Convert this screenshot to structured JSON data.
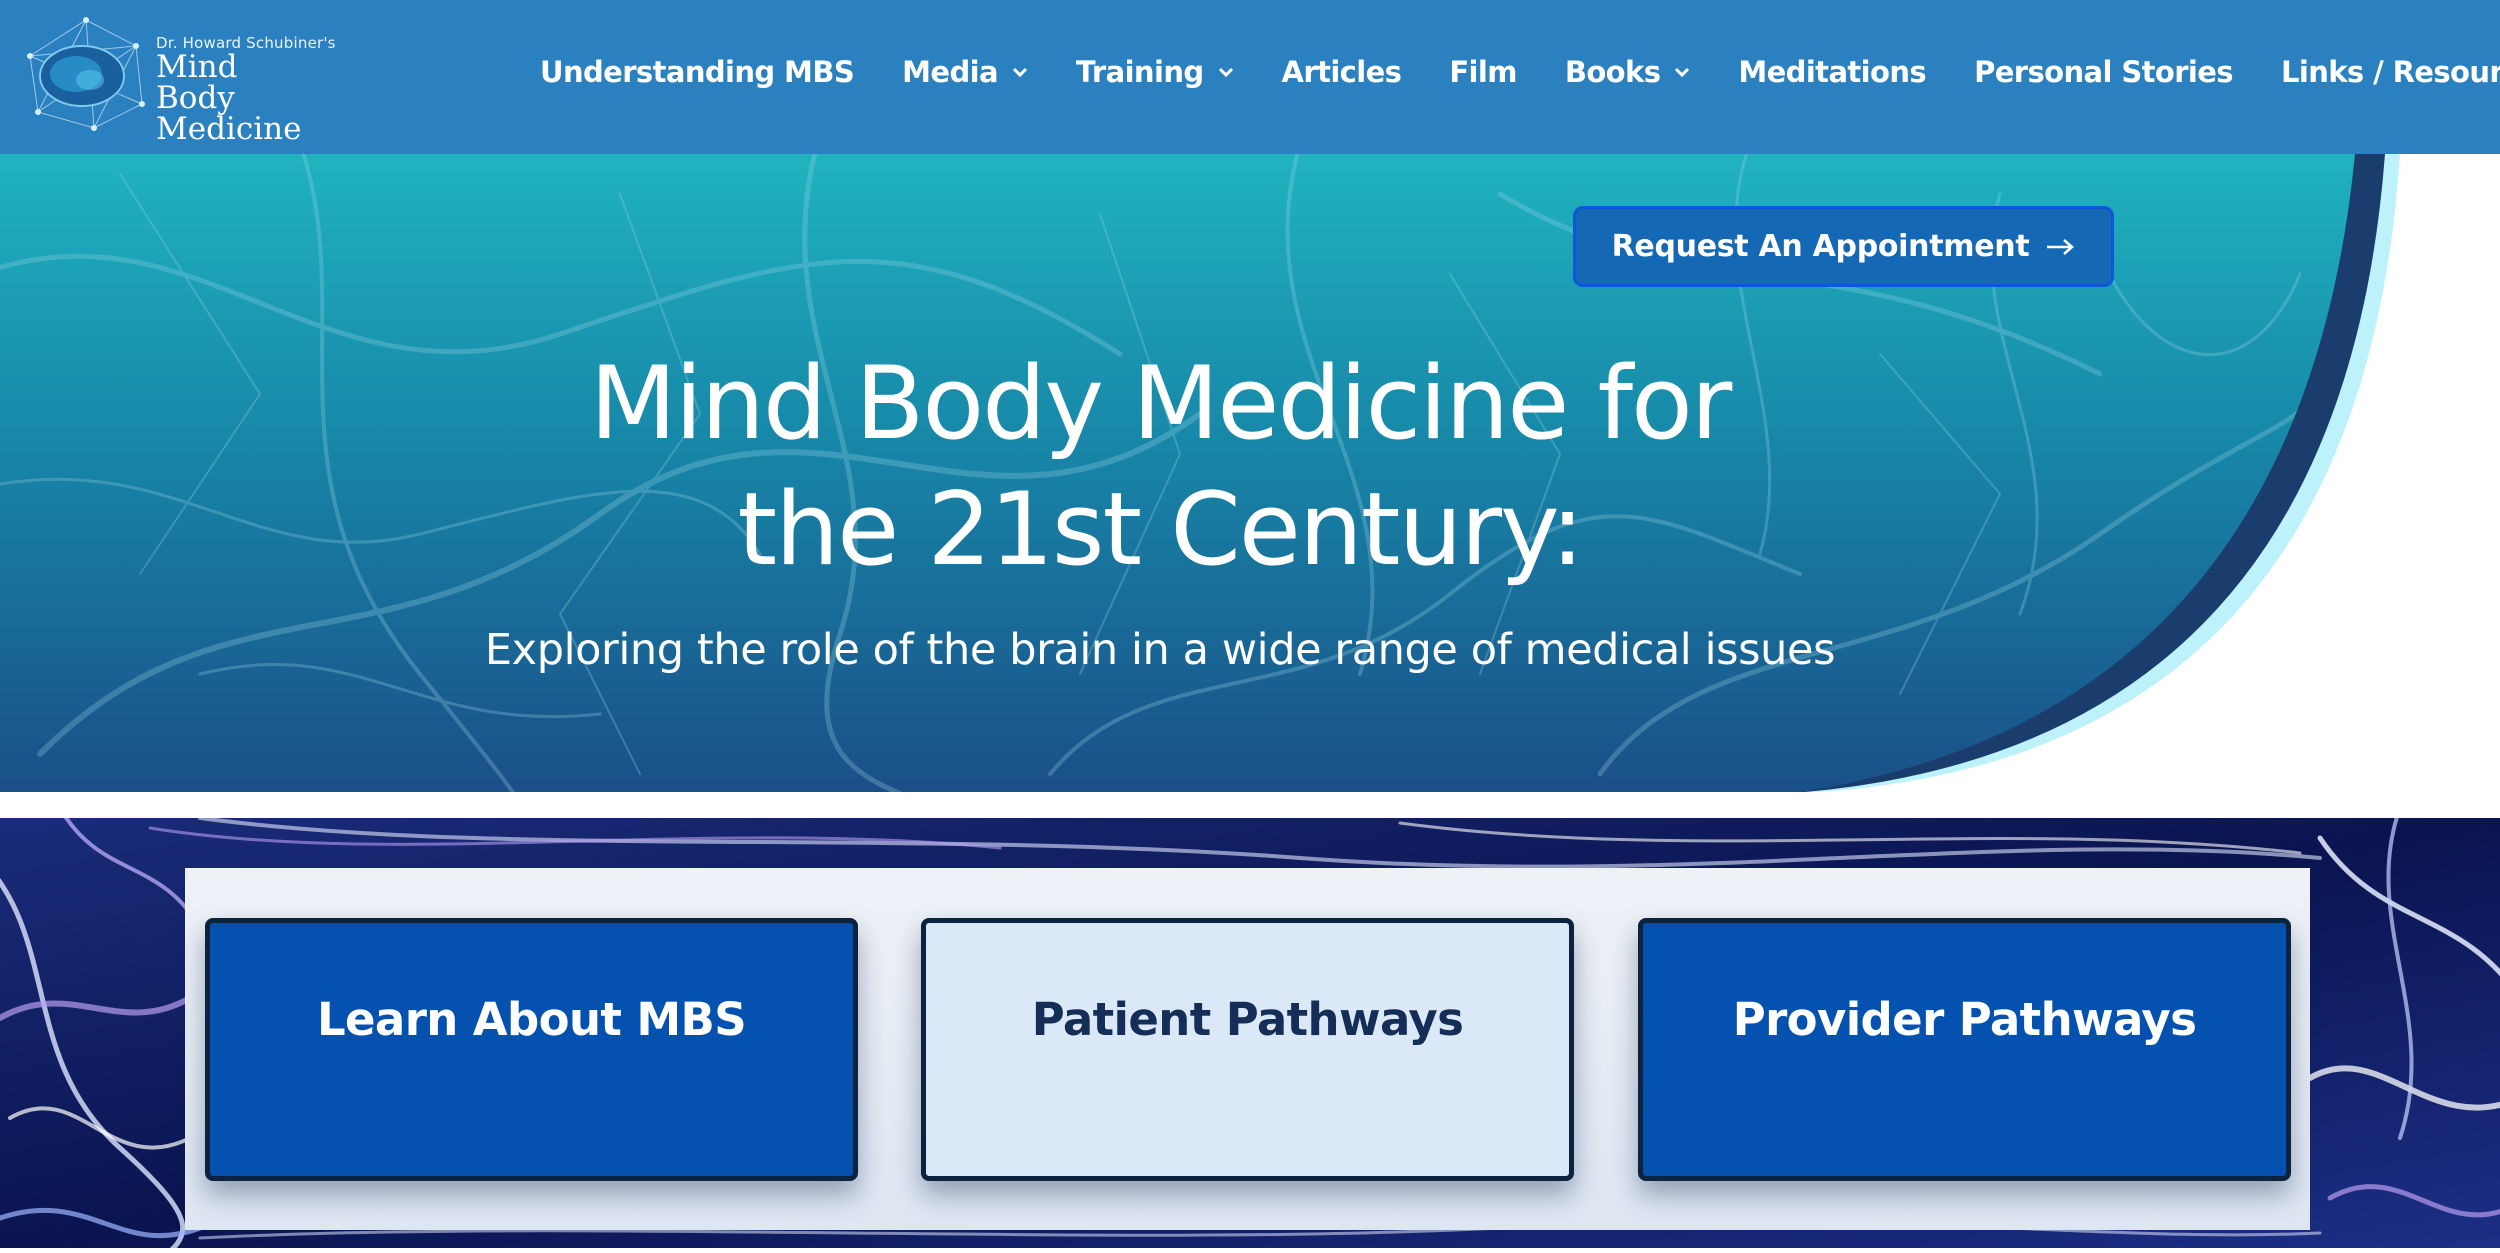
{
  "logo": {
    "small_text": "Dr. Howard Schubiner's",
    "title_line1": "Mind Body",
    "title_line2": "Medicine"
  },
  "nav": {
    "items": [
      {
        "label": "Understanding MBS",
        "has_dropdown": false
      },
      {
        "label": "Media",
        "has_dropdown": true
      },
      {
        "label": "Training",
        "has_dropdown": true
      },
      {
        "label": "Articles",
        "has_dropdown": false
      },
      {
        "label": "Film",
        "has_dropdown": false
      },
      {
        "label": "Books",
        "has_dropdown": true
      },
      {
        "label": "Meditations",
        "has_dropdown": false
      },
      {
        "label": "Personal Stories",
        "has_dropdown": false
      },
      {
        "label": "Links / Resources",
        "has_dropdown": false
      }
    ]
  },
  "hero": {
    "cta_label": "Request An Appointment",
    "cta_icon": "arrow-right-icon",
    "title_line1": "Mind Body Medicine for",
    "title_line2": "the 21st Century:",
    "subtitle": "Exploring the role of the brain in a wide range of medical issues"
  },
  "pathways": {
    "cards": [
      {
        "label": "Learn About MBS",
        "style": "blue"
      },
      {
        "label": "Patient Pathways",
        "style": "light"
      },
      {
        "label": "Provider Pathways",
        "style": "blue"
      }
    ]
  },
  "colors": {
    "header_bg": "#2b80c0",
    "hero_teal": "#1eaab9",
    "hero_navy": "#1b3d6e",
    "hero_accent_cyan": "#bdf2fb",
    "cta_bg": "#1568b4",
    "card_blue": "#0451b0",
    "card_light": "#dbe8f8",
    "card_border": "#0c2340"
  }
}
